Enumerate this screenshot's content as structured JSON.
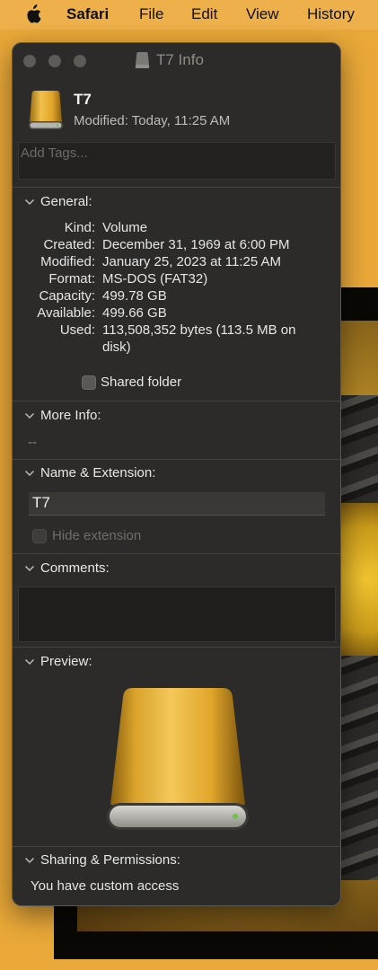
{
  "menubar": {
    "app": "Safari",
    "items": [
      "File",
      "Edit",
      "View",
      "History"
    ],
    "apple_icon": "apple-logo-icon"
  },
  "window": {
    "title": "T7 Info",
    "header": {
      "name": "T7",
      "modified": "Modified: Today, 11:25 AM"
    },
    "tags_placeholder": "Add Tags...",
    "general": {
      "label": "General:",
      "rows": [
        {
          "key": "Kind:",
          "value": "Volume"
        },
        {
          "key": "Created:",
          "value": "December 31, 1969 at 6:00 PM"
        },
        {
          "key": "Modified:",
          "value": "January 25, 2023 at 11:25 AM"
        },
        {
          "key": "Format:",
          "value": "MS-DOS (FAT32)"
        },
        {
          "key": "Capacity:",
          "value": "499.78 GB"
        },
        {
          "key": "Available:",
          "value": "499.66 GB"
        },
        {
          "key": "Used:",
          "value": "113,508,352 bytes (113.5 MB on disk)"
        }
      ],
      "shared_folder_label": "Shared folder"
    },
    "more_info": {
      "label": "More Info:",
      "value": "--"
    },
    "name_extension": {
      "label": "Name & Extension:",
      "name_value": "T7",
      "hide_extension_label": "Hide extension"
    },
    "comments": {
      "label": "Comments:"
    },
    "preview": {
      "label": "Preview:"
    },
    "sharing": {
      "label": "Sharing & Permissions:",
      "text": "You have custom access"
    }
  },
  "colors": {
    "desktop": "#E9A838",
    "window_bg": "#2c2b29",
    "drive_gold": "#E0A52A",
    "drive_light": "#6BC245"
  }
}
